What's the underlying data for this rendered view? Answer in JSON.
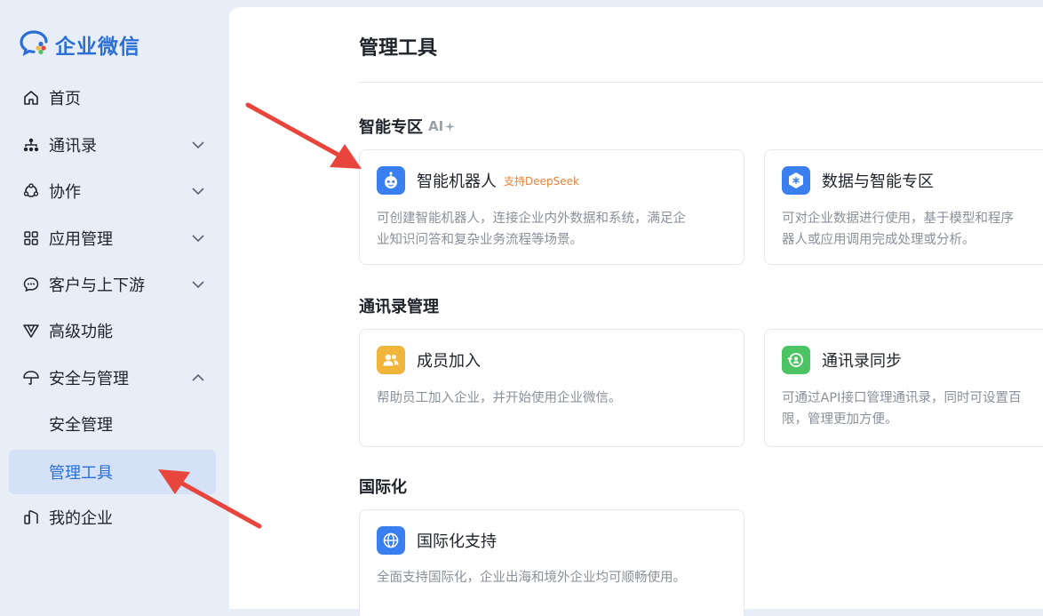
{
  "app": {
    "logo_text": "企业微信"
  },
  "sidebar": {
    "items": [
      {
        "label": "首页",
        "icon": "home-icon"
      },
      {
        "label": "通讯录",
        "icon": "org-chart-icon"
      },
      {
        "label": "协作",
        "icon": "collaboration-icon"
      },
      {
        "label": "应用管理",
        "icon": "apps-grid-icon"
      },
      {
        "label": "客户与上下游",
        "icon": "chat-bubble-icon"
      },
      {
        "label": "高级功能",
        "icon": "premium-v-icon"
      },
      {
        "label": "安全与管理",
        "icon": "umbrella-icon"
      },
      {
        "label": "安全管理"
      },
      {
        "label": "管理工具"
      },
      {
        "label": "我的企业",
        "icon": "building-icon"
      }
    ],
    "active_item": "管理工具"
  },
  "main": {
    "page_title": "管理工具",
    "sections": [
      {
        "title": "智能专区",
        "tag": "AI",
        "cards": [
          {
            "title": "智能机器人",
            "badge": "支持DeepSeek",
            "icon": "robot-icon",
            "desc_line1": "可创建智能机器人，连接企业内外数据和系统，满足企",
            "desc_line2": "业知识问答和复杂业务流程等场景。"
          },
          {
            "title": "数据与智能专区",
            "icon": "data-hexagon-icon",
            "desc_line1": "可对企业数据进行使用，基于模型和程序",
            "desc_line2": "器人或应用调用完成处理或分析。"
          }
        ]
      },
      {
        "title": "通讯录管理",
        "cards": [
          {
            "title": "成员加入",
            "icon": "members-icon",
            "desc_line1": "帮助员工加入企业，并开始使用企业微信。"
          },
          {
            "title": "通讯录同步",
            "icon": "sync-icon",
            "desc_line1": "可通过API接口管理通讯录，同时可设置百",
            "desc_line2": "限，管理更加方便。"
          }
        ]
      },
      {
        "title": "国际化",
        "cards": [
          {
            "title": "国际化支持",
            "icon": "globe-icon",
            "desc_line1": "全面支持国际化，企业出海和境外企业均可顺畅使用。"
          }
        ]
      }
    ]
  },
  "colors": {
    "brand_blue": "#2b6fd6",
    "badge_orange": "#e8833a",
    "members_icon_bg": "#f2b53c",
    "sync_icon_bg": "#4cc463",
    "arrow_red": "#e8453c"
  }
}
